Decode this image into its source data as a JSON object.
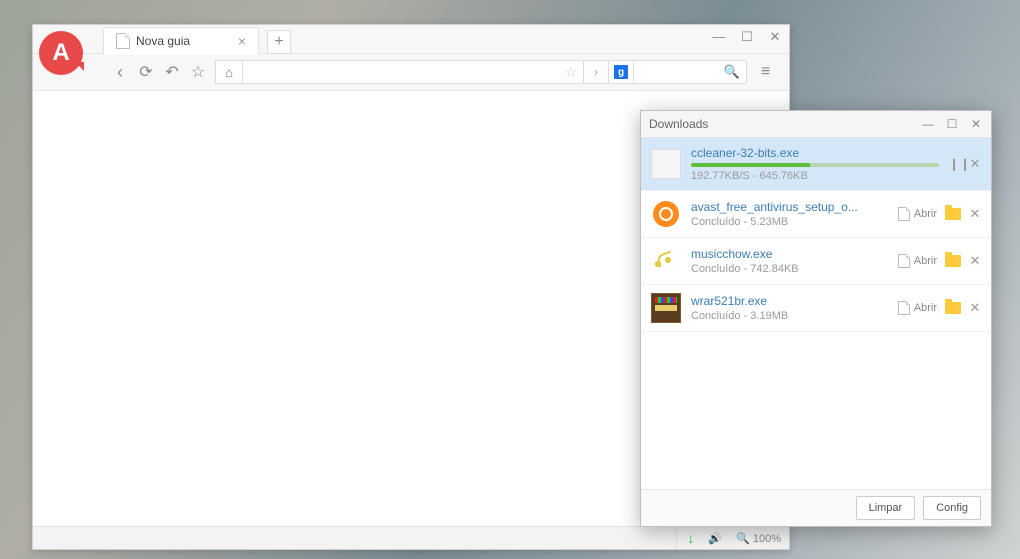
{
  "browser": {
    "logo_letter": "A",
    "tab_title": "Nova guia",
    "url": "",
    "search_engine_letter": "g",
    "zoom": "100%"
  },
  "downloads": {
    "title": "Downloads",
    "clear_label": "Limpar",
    "config_label": "Config",
    "open_label": "Abrir",
    "items": [
      {
        "name": "ccleaner-32-bits.exe",
        "meta": "192.77KB/S - 645.76KB",
        "active": true
      },
      {
        "name": "avast_free_antivirus_setup_o...",
        "meta": "Concluído - 5.23MB",
        "active": false
      },
      {
        "name": "musicchow.exe",
        "meta": "Concluído - 742.84KB",
        "active": false
      },
      {
        "name": "wrar521br.exe",
        "meta": "Concluído - 3.19MB",
        "active": false
      }
    ]
  }
}
